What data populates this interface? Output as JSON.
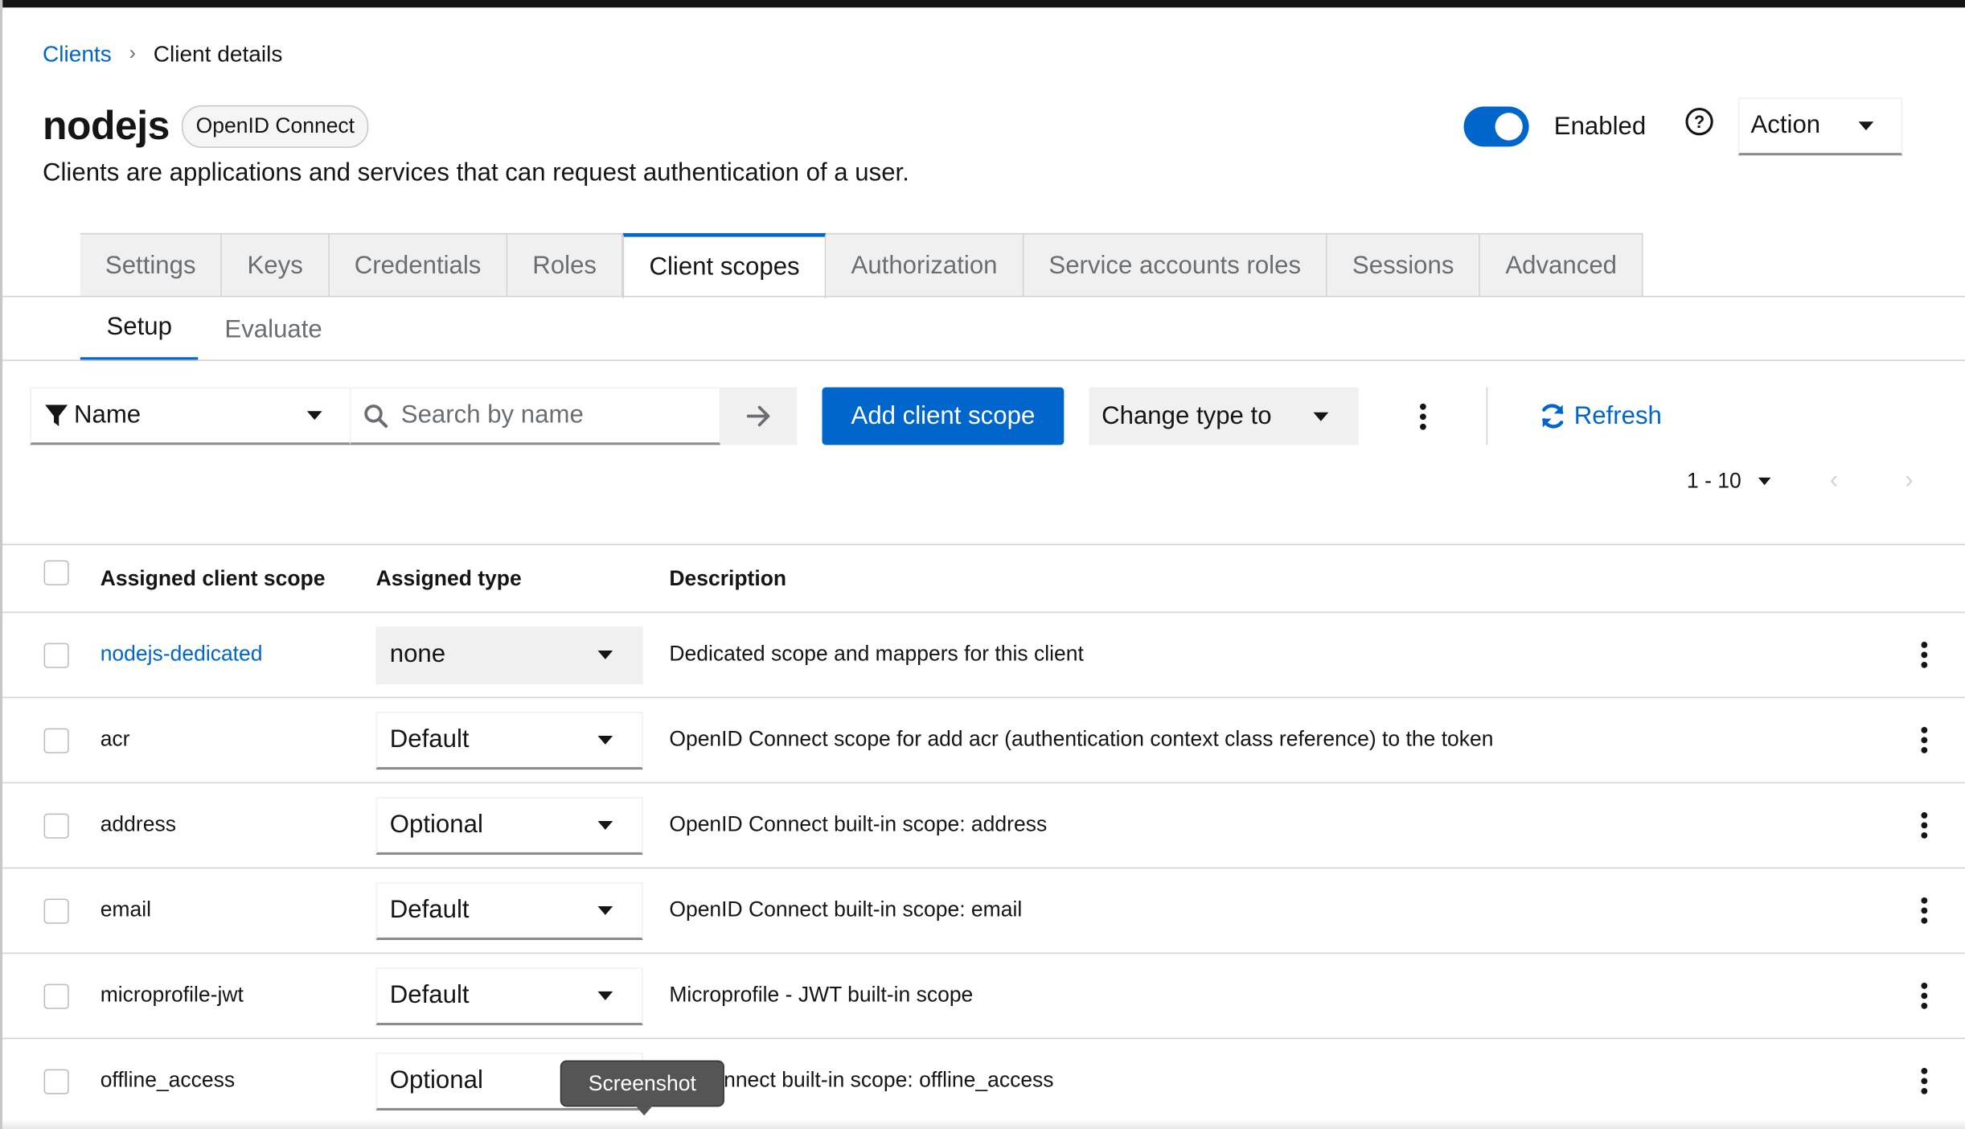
{
  "breadcrumb": {
    "parent": "Clients",
    "separator": "›",
    "current": "Client details"
  },
  "client": {
    "name": "nodejs",
    "protocol_badge": "OpenID Connect",
    "subtitle": "Clients are applications and services that can request authentication of a user.",
    "enabled_label": "Enabled",
    "enabled": true,
    "action_label": "Action"
  },
  "tabs": [
    {
      "label": "Settings",
      "active": false
    },
    {
      "label": "Keys",
      "active": false
    },
    {
      "label": "Credentials",
      "active": false
    },
    {
      "label": "Roles",
      "active": false
    },
    {
      "label": "Client scopes",
      "active": true
    },
    {
      "label": "Authorization",
      "active": false
    },
    {
      "label": "Service accounts roles",
      "active": false
    },
    {
      "label": "Sessions",
      "active": false
    },
    {
      "label": "Advanced",
      "active": false
    }
  ],
  "subtabs": [
    {
      "label": "Setup",
      "active": true
    },
    {
      "label": "Evaluate",
      "active": false
    }
  ],
  "toolbar": {
    "filter_label": "Name",
    "search_placeholder": "Search by name",
    "add_label": "Add client scope",
    "change_type_label": "Change type to",
    "refresh_label": "Refresh"
  },
  "pagination": {
    "range": "1 - 10"
  },
  "table": {
    "headers": {
      "scope": "Assigned client scope",
      "type": "Assigned type",
      "description": "Description"
    },
    "rows": [
      {
        "name": "nodejs-dedicated",
        "type": "none",
        "description": "Dedicated scope and mappers for this client",
        "link": true
      },
      {
        "name": "acr",
        "type": "Default",
        "description": "OpenID Connect scope for add acr (authentication context class reference) to the token",
        "link": false
      },
      {
        "name": "address",
        "type": "Optional",
        "description": "OpenID Connect built-in scope: address",
        "link": false
      },
      {
        "name": "email",
        "type": "Default",
        "description": "OpenID Connect built-in scope: email",
        "link": false
      },
      {
        "name": "microprofile-jwt",
        "type": "Default",
        "description": "Microprofile - JWT built-in scope",
        "link": false
      },
      {
        "name": "offline_access",
        "type": "Optional",
        "description": "ID Connect built-in scope: offline_access",
        "link": false
      }
    ]
  },
  "tooltip": {
    "text": "Screenshot"
  },
  "colors": {
    "accent": "#0066cc",
    "text": "#151515",
    "muted": "#6a6e73",
    "border": "#d2d2d2"
  }
}
